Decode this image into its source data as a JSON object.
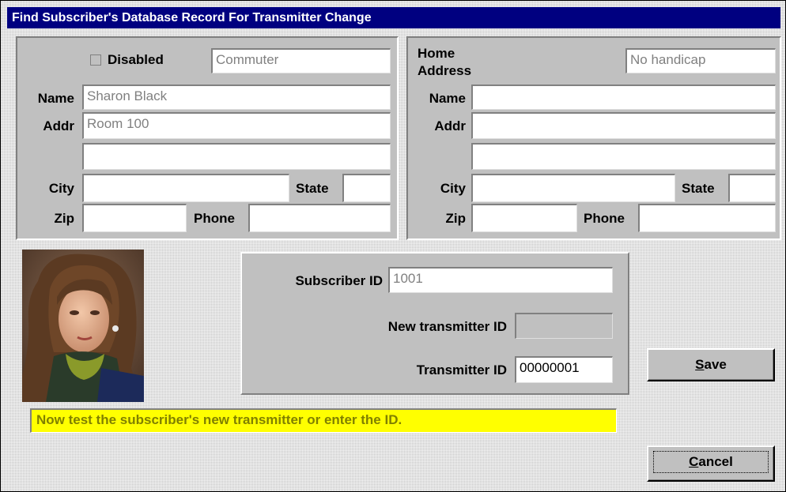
{
  "window": {
    "title": "Find Subscriber's Database Record For Transmitter Change"
  },
  "left_panel": {
    "disabled_label": "Disabled",
    "disabled_checked": false,
    "category_value": "Commuter",
    "name_label": "Name",
    "name_value": "Sharon Black",
    "addr_label": "Addr",
    "addr1_value": "Room 100",
    "addr2_value": "",
    "city_label": "City",
    "city_value": "",
    "state_label": "State",
    "state_value": "",
    "zip_label": "Zip",
    "zip_value": "",
    "phone_label": "Phone",
    "phone_value": ""
  },
  "right_panel": {
    "home_label": "Home",
    "address_label": "Address",
    "handicap_value": "No handicap",
    "name_label": "Name",
    "name_value": "",
    "addr_label": "Addr",
    "addr1_value": "",
    "addr2_value": "",
    "city_label": "City",
    "city_value": "",
    "state_label": "State",
    "state_value": "",
    "zip_label": "Zip",
    "zip_value": "",
    "phone_label": "Phone",
    "phone_value": ""
  },
  "ids_panel": {
    "subscriber_id_label": "Subscriber ID",
    "subscriber_id_value": "1001",
    "new_transmitter_label": "New transmitter ID",
    "new_transmitter_value": "",
    "transmitter_id_label": "Transmitter ID",
    "transmitter_id_value": "00000001"
  },
  "status_message": "Now test the subscriber's new transmitter or enter the ID.",
  "buttons": {
    "save_mnemonic": "S",
    "save_rest": "ave",
    "cancel_mnemonic": "C",
    "cancel_rest": "ancel"
  },
  "colors": {
    "title_bar": "#000080",
    "status_background": "#ffff00",
    "status_text": "#808000"
  }
}
